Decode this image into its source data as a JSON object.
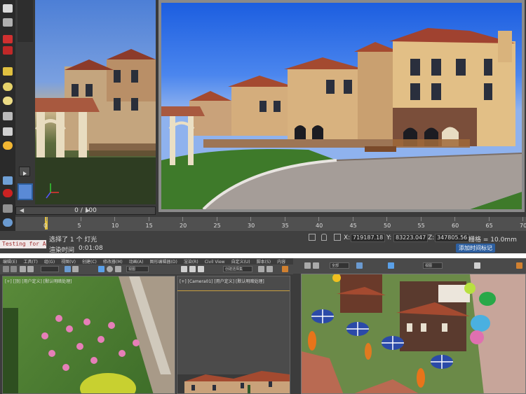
{
  "timeline": {
    "frame_slider": "0 / 100",
    "ticks": [
      "0",
      "5",
      "10",
      "15",
      "20",
      "25",
      "30",
      "35",
      "40",
      "45",
      "50",
      "55",
      "60",
      "65",
      "70"
    ]
  },
  "status": {
    "maxscript": "Testing for All",
    "selection": "选择了 1 个 灯光",
    "render_time_label": "渲染时间",
    "render_time_value": "0:01:08",
    "x_label": "X:",
    "x_value": "719187.18",
    "y_label": "Y:",
    "y_value": "83223.047",
    "z_label": "Z:",
    "z_value": "347805.56",
    "grid": "栅格 = 10.0mm",
    "add_tag": "添加时间标记"
  },
  "bottom": {
    "menu_left": [
      "编辑(E)",
      "工具(T)",
      "组(G)",
      "视图(V)",
      "创建(C)",
      "修改器(M)",
      "动画(A)",
      "图形编辑器(D)",
      "渲染(R)",
      "Civil View",
      "自定义(U)",
      "脚本(S)",
      "内容"
    ],
    "combo_left": "视图",
    "combo_sel": "创建选择集",
    "vp_left_label": "[+] [顶] [用户定义] [默认明暗处理]",
    "vp_mid_label": "[+] [Camera01] [用户定义] [默认明暗处理]",
    "combo_right_a": "全部",
    "combo_right_b": "视图"
  },
  "colors": {
    "accent_blue": "#2d5fa0",
    "timeline_bg": "#505050",
    "maxscript_text": "#a03030"
  }
}
